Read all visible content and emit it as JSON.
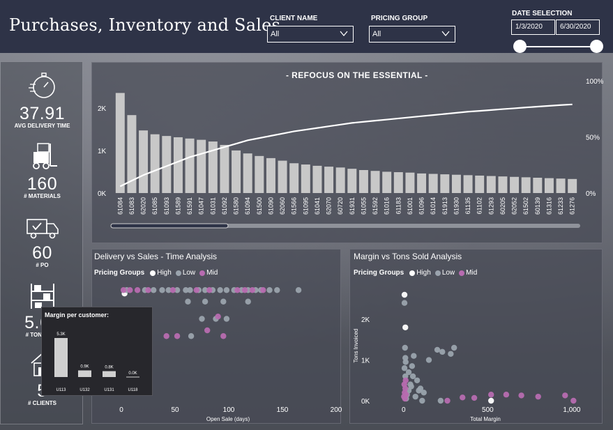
{
  "header": {
    "title": "Purchases, Inventory and Sales",
    "client_name_label": "CLIENT NAME",
    "client_name_value": "All",
    "pricing_group_label": "PRICING GROUP",
    "pricing_group_value": "All",
    "date_selection_label": "DATE SELECTION",
    "date_start": "1/3/2020",
    "date_end": "6/30/2020"
  },
  "kpis": [
    {
      "value": "37.91",
      "label": "AVG DELIVERY TIME",
      "icon": "stopwatch-icon"
    },
    {
      "value": "160",
      "label": "# MATERIALS",
      "icon": "forklift-icon"
    },
    {
      "value": "60",
      "label": "# PO",
      "icon": "truck-icon"
    },
    {
      "value": "5.68",
      "label": "# TONS NOT",
      "icon": "warehouse-shelves-icon"
    },
    {
      "value": "5",
      "label": "# CLIENTS",
      "icon": "house-icon"
    }
  ],
  "colors": {
    "header_bg": "#2e3347",
    "bar": "#c8c8c8",
    "line": "#ffffff",
    "low": "#9aa3ad",
    "mid": "#b76bb0",
    "high": "#ffffff"
  },
  "pareto": {
    "title": "- REFOCUS ON THE ESSENTIAL -"
  },
  "delivery": {
    "title": "Delivery vs Sales - Time Analysis",
    "legend_title": "Pricing Groups",
    "legend": [
      "High",
      "Low",
      "Mid"
    ]
  },
  "margin": {
    "title": "Margin vs Tons Sold Analysis",
    "legend_title": "Pricing Groups",
    "legend": [
      "High",
      "Low",
      "Mid"
    ]
  },
  "tooltip": {
    "title": "Margin per customer:"
  },
  "chart_data": [
    {
      "type": "bar",
      "title": "- REFOCUS ON THE ESSENTIAL -",
      "categories": [
        "61084",
        "61083",
        "62020",
        "61085",
        "61093",
        "61589",
        "61591",
        "61047",
        "61031",
        "61092",
        "61580",
        "61094",
        "61500",
        "61090",
        "62060",
        "61566",
        "61095",
        "61041",
        "62070",
        "60720",
        "61931",
        "61055",
        "61592",
        "61016",
        "61183",
        "61001",
        "61096",
        "61014",
        "61913",
        "61930",
        "61135",
        "61102",
        "61293",
        "60205",
        "62052",
        "61502",
        "60139",
        "61316",
        "61233",
        "61276"
      ],
      "series": [
        {
          "type": "bar",
          "values": [
            2350,
            1830,
            1470,
            1380,
            1340,
            1310,
            1280,
            1250,
            1210,
            1130,
            1000,
            930,
            870,
            820,
            760,
            700,
            670,
            640,
            620,
            600,
            570,
            540,
            520,
            500,
            490,
            480,
            460,
            450,
            440,
            430,
            420,
            410,
            400,
            390,
            380,
            370,
            360,
            350,
            340,
            330
          ]
        },
        {
          "type": "line",
          "values": [
            6,
            11,
            16,
            20,
            24,
            28,
            32,
            35,
            38,
            41,
            44,
            47,
            49,
            51,
            53,
            55,
            56.5,
            58,
            59.5,
            61,
            62.5,
            63.5,
            64.5,
            65.5,
            66.5,
            67.5,
            68.5,
            69.5,
            70.5,
            71.5,
            72.5,
            73.2,
            74,
            74.8,
            75.5,
            76.3,
            77,
            77.7,
            78.4,
            79
          ]
        }
      ],
      "y_ticks": [
        "0K",
        "1K",
        "2K"
      ],
      "y2_ticks": [
        "0%",
        "50%",
        "100%"
      ],
      "ylim": [
        0,
        2700
      ],
      "y2lim": [
        0,
        100
      ]
    },
    {
      "type": "scatter",
      "title": "Delivery vs Sales - Time Analysis",
      "xlabel": "Open Sale (days)",
      "x_ticks": [
        "0",
        "50",
        "100",
        "150",
        "200"
      ],
      "xlim": [
        0,
        200
      ],
      "ylim": [
        0,
        100
      ],
      "series": [
        {
          "name": "High",
          "points": [
            [
              3,
              92
            ]
          ]
        },
        {
          "name": "Low",
          "points": [
            [
              5,
              95
            ],
            [
              22,
              95
            ],
            [
              30,
              95
            ],
            [
              38,
              95
            ],
            [
              44,
              95
            ],
            [
              52,
              95
            ],
            [
              60,
              95
            ],
            [
              64,
              95
            ],
            [
              72,
              95
            ],
            [
              78,
              95
            ],
            [
              85,
              95
            ],
            [
              92,
              95
            ],
            [
              98,
              95
            ],
            [
              105,
              95
            ],
            [
              112,
              95
            ],
            [
              118,
              95
            ],
            [
              125,
              95
            ],
            [
              130,
              95
            ],
            [
              138,
              95
            ],
            [
              145,
              95
            ],
            [
              165,
              95
            ],
            [
              62,
              85
            ],
            [
              78,
              85
            ],
            [
              95,
              85
            ],
            [
              118,
              85
            ],
            [
              88,
              70
            ],
            [
              75,
              70
            ],
            [
              98,
              70
            ],
            [
              65,
              55
            ]
          ]
        },
        {
          "name": "Mid",
          "points": [
            [
              2,
              95
            ],
            [
              8,
              95
            ],
            [
              15,
              95
            ],
            [
              25,
              95
            ],
            [
              48,
              95
            ],
            [
              70,
              95
            ],
            [
              82,
              95
            ],
            [
              108,
              95
            ],
            [
              115,
              95
            ],
            [
              122,
              95
            ],
            [
              132,
              95
            ],
            [
              95,
              55
            ],
            [
              80,
              60
            ],
            [
              42,
              55
            ],
            [
              52,
              55
            ],
            [
              90,
              72
            ]
          ]
        }
      ]
    },
    {
      "type": "scatter",
      "title": "Margin vs Tons Sold Analysis",
      "xlabel": "Total Margin",
      "ylabel": "Tons Invoiced",
      "x_ticks": [
        "0",
        "500",
        "1,000"
      ],
      "y_ticks": [
        "0K",
        "1K",
        "2K"
      ],
      "xlim": [
        -20,
        1050
      ],
      "ylim": [
        0,
        2600
      ],
      "series": [
        {
          "name": "High",
          "points": [
            [
              5,
              2600
            ],
            [
              10,
              1800
            ],
            [
              520,
              0
            ]
          ]
        },
        {
          "name": "Low",
          "points": [
            [
              5,
              2400
            ],
            [
              8,
              1300
            ],
            [
              10,
              1050
            ],
            [
              12,
              950
            ],
            [
              5,
              800
            ],
            [
              30,
              700
            ],
            [
              55,
              600
            ],
            [
              80,
              500
            ],
            [
              100,
              300
            ],
            [
              120,
              200
            ],
            [
              150,
              1000
            ],
            [
              200,
              1250
            ],
            [
              230,
              1200
            ],
            [
              280,
              1150
            ],
            [
              300,
              1300
            ],
            [
              60,
              1100
            ],
            [
              40,
              400
            ],
            [
              20,
              150
            ],
            [
              70,
              100
            ],
            [
              90,
              250
            ],
            [
              30,
              250
            ],
            [
              15,
              50
            ],
            [
              45,
              350
            ],
            [
              110,
              0
            ],
            [
              220,
              0
            ],
            [
              10,
              600
            ],
            [
              50,
              850
            ]
          ]
        },
        {
          "name": "Mid",
          "points": [
            [
              2,
              100
            ],
            [
              6,
              200
            ],
            [
              10,
              300
            ],
            [
              14,
              150
            ],
            [
              4,
              400
            ],
            [
              260,
              0
            ],
            [
              350,
              80
            ],
            [
              420,
              70
            ],
            [
              520,
              150
            ],
            [
              610,
              150
            ],
            [
              700,
              130
            ],
            [
              800,
              100
            ],
            [
              960,
              130
            ],
            [
              1010,
              0
            ],
            [
              8,
              50
            ],
            [
              12,
              500
            ]
          ]
        }
      ]
    },
    {
      "type": "bar",
      "title": "Margin per customer:",
      "categories": [
        "U113",
        "U132",
        "U131",
        "U118"
      ],
      "values": [
        5.3,
        0.9,
        0.8,
        0.0
      ],
      "labels": [
        "5.3K",
        "0.9K",
        "0.8K",
        "0.0K"
      ]
    }
  ]
}
